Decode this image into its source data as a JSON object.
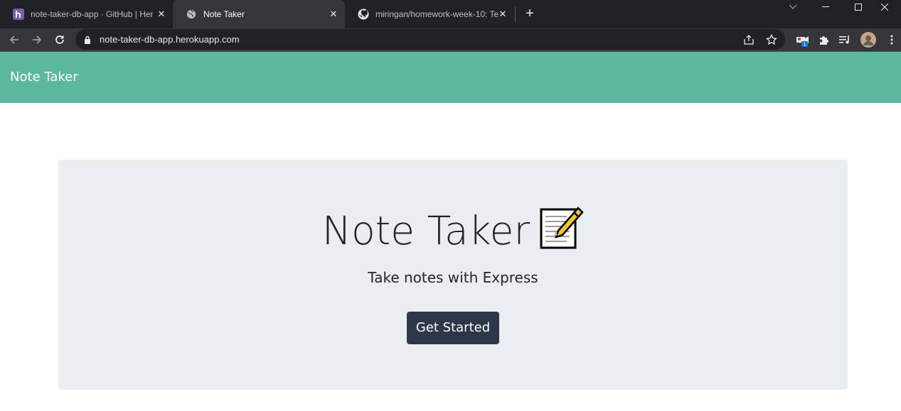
{
  "browser": {
    "tabs": [
      {
        "title": "note-taker-db-app · GitHub | Heroku",
        "favicon": "heroku-icon",
        "active": false
      },
      {
        "title": "Note Taker",
        "favicon": "globe-icon",
        "active": true
      },
      {
        "title": "miringan/homework-week-10: Te",
        "favicon": "github-icon",
        "active": false
      }
    ],
    "url": "note-taker-db-app.herokuapp.com",
    "extension_badge": "1"
  },
  "page": {
    "brand": "Note Taker",
    "hero": {
      "title": "Note Taker",
      "subtitle": "Take notes with Express",
      "button_label": "Get Started"
    }
  },
  "colors": {
    "navbar": "#5cb89c",
    "jumbotron": "#ebeef0",
    "button": "#2e3649",
    "chrome_dark": "#202124",
    "chrome_mid": "#35363a"
  }
}
